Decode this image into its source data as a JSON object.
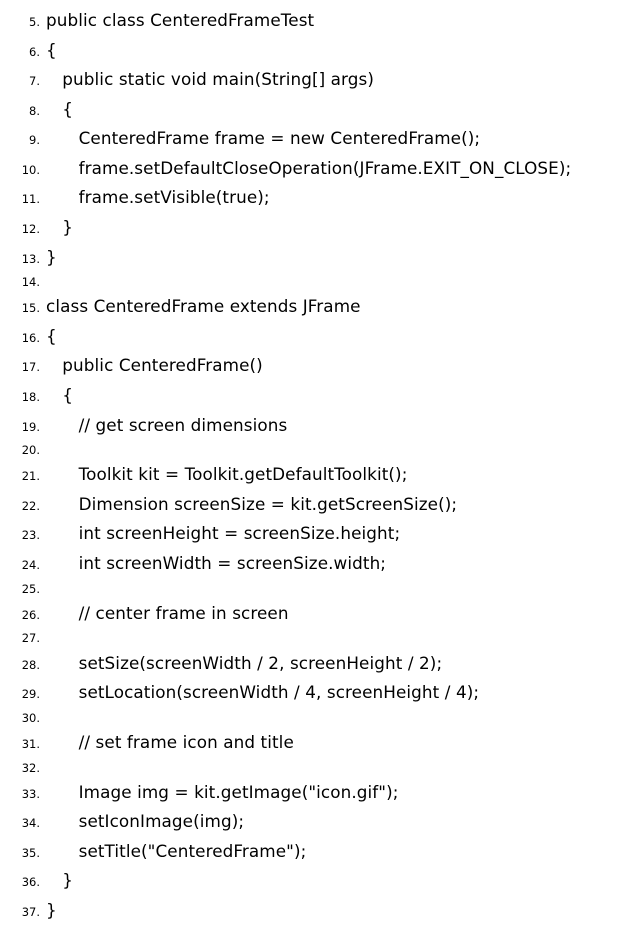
{
  "lines": [
    {
      "n": "5.",
      "code": "public class CenteredFrameTest"
    },
    {
      "n": "6.",
      "code": "{"
    },
    {
      "n": "7.",
      "code": "   public static void main(String[] args)"
    },
    {
      "n": "8.",
      "code": "   {"
    },
    {
      "n": "9.",
      "code": "      CenteredFrame frame = new CenteredFrame();"
    },
    {
      "n": "10.",
      "code": "      frame.setDefaultCloseOperation(JFrame.EXIT_ON_CLOSE);"
    },
    {
      "n": "11.",
      "code": "      frame.setVisible(true);"
    },
    {
      "n": "12.",
      "code": "   }"
    },
    {
      "n": "13.",
      "code": "}"
    },
    {
      "n": "14.",
      "code": ""
    },
    {
      "n": "15.",
      "code": "class CenteredFrame extends JFrame"
    },
    {
      "n": "16.",
      "code": "{"
    },
    {
      "n": "17.",
      "code": "   public CenteredFrame()"
    },
    {
      "n": "18.",
      "code": "   {"
    },
    {
      "n": "19.",
      "code": "      // get screen dimensions"
    },
    {
      "n": "20.",
      "code": ""
    },
    {
      "n": "21.",
      "code": "      Toolkit kit = Toolkit.getDefaultToolkit();"
    },
    {
      "n": "22.",
      "code": "      Dimension screenSize = kit.getScreenSize();"
    },
    {
      "n": "23.",
      "code": "      int screenHeight = screenSize.height;"
    },
    {
      "n": "24.",
      "code": "      int screenWidth = screenSize.width;"
    },
    {
      "n": "25.",
      "code": ""
    },
    {
      "n": "26.",
      "code": "      // center frame in screen"
    },
    {
      "n": "27.",
      "code": ""
    },
    {
      "n": "28.",
      "code": "      setSize(screenWidth / 2, screenHeight / 2);"
    },
    {
      "n": "29.",
      "code": "      setLocation(screenWidth / 4, screenHeight / 4);"
    },
    {
      "n": "30.",
      "code": ""
    },
    {
      "n": "31.",
      "code": "      // set frame icon and title"
    },
    {
      "n": "32.",
      "code": ""
    },
    {
      "n": "33.",
      "code": "      Image img = kit.getImage(\"icon.gif\");"
    },
    {
      "n": "34.",
      "code": "      setIconImage(img);"
    },
    {
      "n": "35.",
      "code": "      setTitle(\"CenteredFrame\");"
    },
    {
      "n": "36.",
      "code": "   }"
    },
    {
      "n": "37.",
      "code": "}"
    }
  ]
}
